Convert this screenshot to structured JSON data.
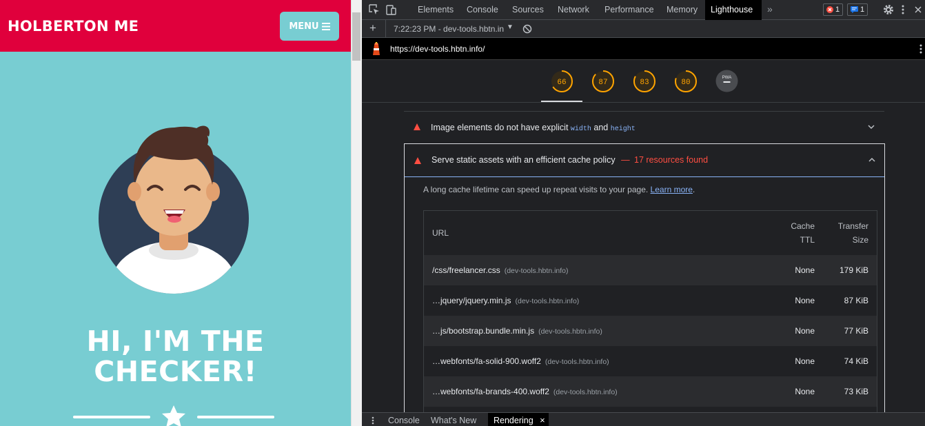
{
  "page": {
    "brand": "HOLBERTON ME",
    "menu_label": "MENU",
    "hero_line1": "HI, I'M THE",
    "hero_line2": "CHECKER!"
  },
  "devtools": {
    "tabs": [
      "Elements",
      "Console",
      "Sources",
      "Network",
      "Performance",
      "Memory",
      "Lighthouse"
    ],
    "active_tab": "Lighthouse",
    "error_count": "1",
    "message_count": "1",
    "report_label": "7:22:23 PM - dev-tools.hbtn.in",
    "url": "https://dev-tools.hbtn.info/",
    "scores": [
      "66",
      "87",
      "83",
      "80"
    ],
    "pwa_label": "PWA",
    "score_fractions": [
      0.66,
      0.87,
      0.83,
      0.8
    ],
    "colors": {
      "average": "#ffa400",
      "fail": "#ff4e42",
      "link": "#8ab4f8"
    },
    "audit1_prefix": "Image elements do not have explicit",
    "audit1_code1": "width",
    "audit1_and": "and",
    "audit1_code2": "height",
    "audit2_title": "Serve static assets with an efficient cache policy",
    "audit2_dash": "—",
    "audit2_found": "17 resources found",
    "description": "A long cache lifetime can speed up repeat visits to your page.",
    "learn_more": "Learn more",
    "table": {
      "col_url": "URL",
      "col_ttl_1": "Cache",
      "col_ttl_2": "TTL",
      "col_size_1": "Transfer",
      "col_size_2": "Size",
      "rows": [
        {
          "url": "/css/freelancer.css",
          "host": "(dev-tools.hbtn.info)",
          "ttl": "None",
          "size": "179 KiB"
        },
        {
          "url": "…jquery/jquery.min.js",
          "host": "(dev-tools.hbtn.info)",
          "ttl": "None",
          "size": "87 KiB"
        },
        {
          "url": "…js/bootstrap.bundle.min.js",
          "host": "(dev-tools.hbtn.info)",
          "ttl": "None",
          "size": "77 KiB"
        },
        {
          "url": "…webfonts/fa-solid-900.woff2",
          "host": "(dev-tools.hbtn.info)",
          "ttl": "None",
          "size": "74 KiB"
        },
        {
          "url": "…webfonts/fa-brands-400.woff2",
          "host": "(dev-tools.hbtn.info)",
          "ttl": "None",
          "size": "73 KiB"
        }
      ]
    },
    "drawer_tabs": [
      "Console",
      "What's New",
      "Rendering"
    ]
  }
}
